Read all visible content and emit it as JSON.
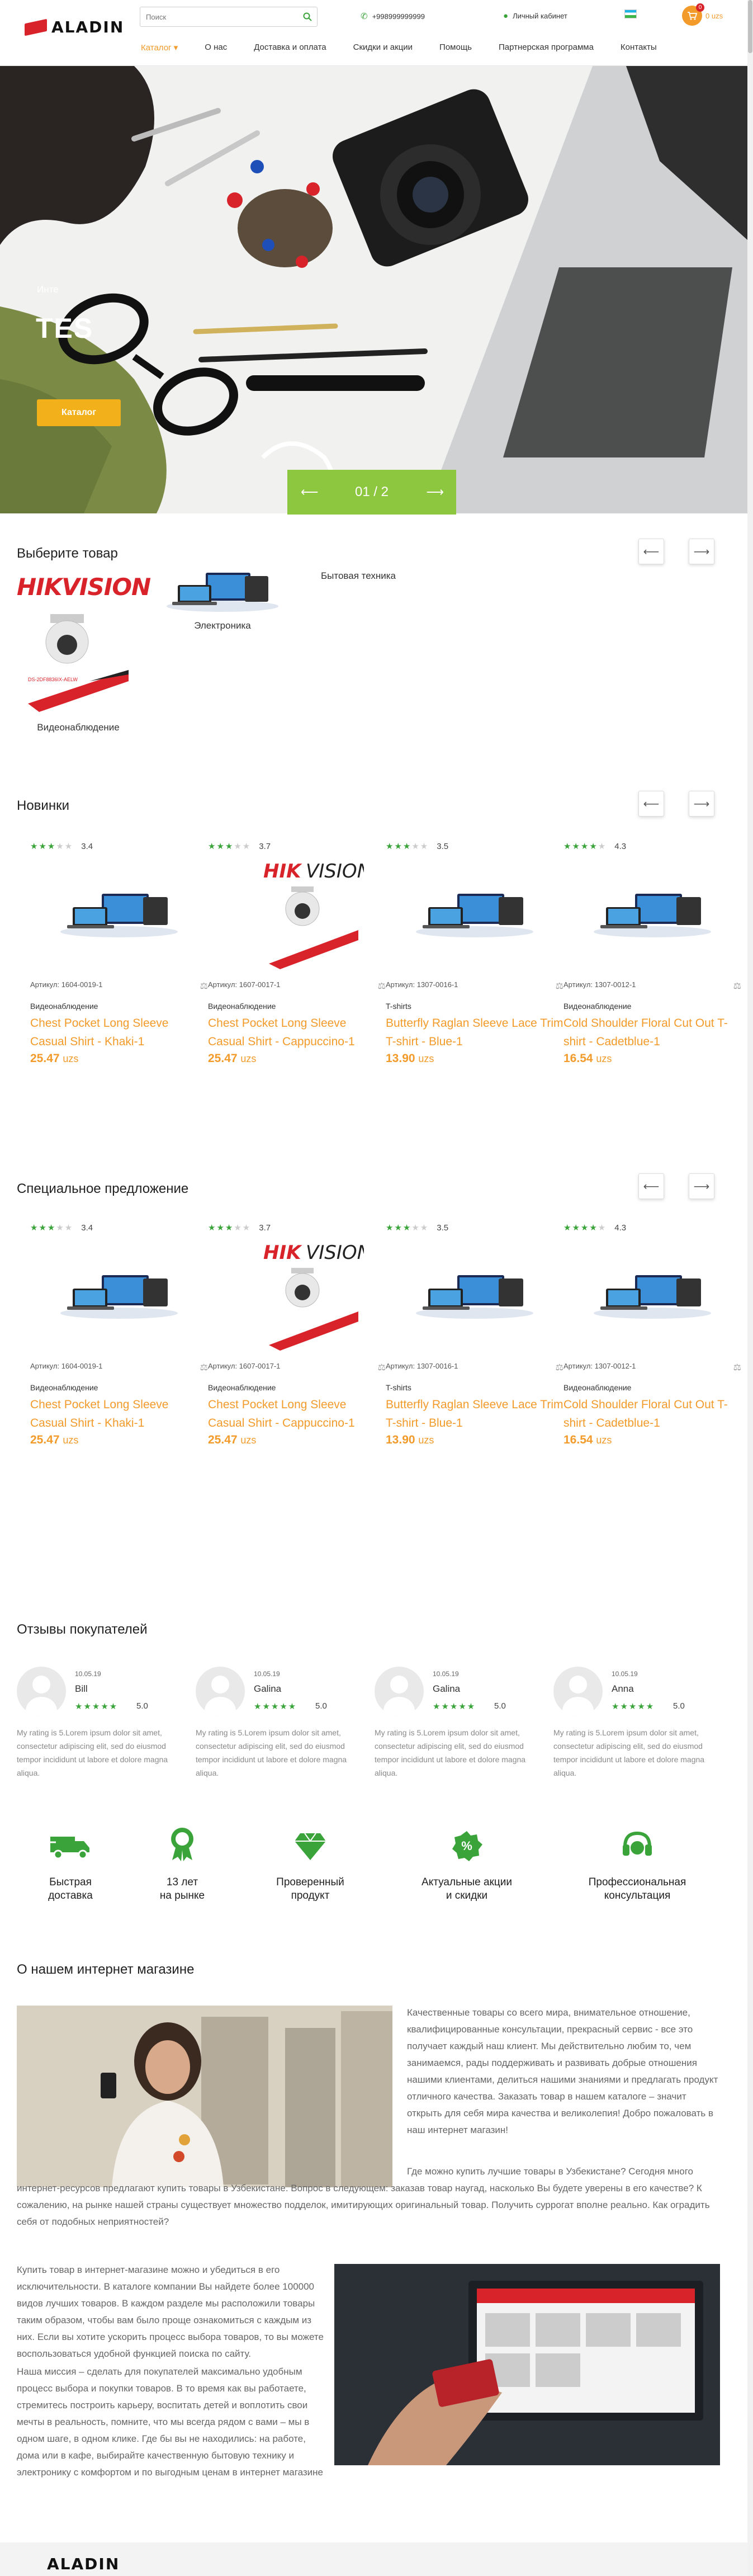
{
  "header": {
    "logo": "ALADIN",
    "search_placeholder": "Поиск",
    "phone": "+998999999999",
    "cabinet": "Личный кабинет",
    "cart_count": "0",
    "cart_sum": "0 uzs",
    "menu": [
      "Каталог",
      "О нас",
      "Доставка и оплата",
      "Скидки и акции",
      "Помощь",
      "Партнерская программа",
      "Контакты"
    ]
  },
  "hero": {
    "subtitle": "Инте",
    "title": "TES",
    "button": "Каталог",
    "counter": "01 / 2",
    "prev": "⟵",
    "next": "⟶"
  },
  "categories_section": {
    "title": "Выберите товар",
    "items": [
      "Электроника",
      "Бытовая техника",
      "Видеонаблюдение"
    ],
    "brand": "HIKVISION"
  },
  "new_section": {
    "title": "Новинки"
  },
  "special_section": {
    "title": "Специальное предложение"
  },
  "products": [
    {
      "rating": "3.4",
      "stars": 3,
      "sku": "Артикул: 1604-0019-1",
      "category": "Видеонаблюдение",
      "name": "Chest Pocket Long Sleeve Casual Shirt - Khaki-1",
      "price": "25.47",
      "currency": "uzs",
      "image": "electronics"
    },
    {
      "rating": "3.7",
      "stars": 3,
      "sku": "Артикул: 1607-0017-1",
      "category": "Видеонаблюдение",
      "name": "Chest Pocket Long Sleeve Casual Shirt - Cappuccino-1",
      "price": "25.47",
      "currency": "uzs",
      "image": "hikvision"
    },
    {
      "rating": "3.5",
      "stars": 3,
      "sku": "Артикул: 1307-0016-1",
      "category": "T-shirts",
      "name": "Butterfly Raglan Sleeve Lace Trim T-shirt - Blue-1",
      "price": "13.90",
      "currency": "uzs",
      "image": "electronics"
    },
    {
      "rating": "4.3",
      "stars": 4,
      "sku": "Артикул: 1307-0012-1",
      "category": "Видеонаблюдение",
      "name": "Cold Shoulder Floral Cut Out T-shirt - Cadetblue-1",
      "price": "16.54",
      "currency": "uzs",
      "image": "electronics"
    }
  ],
  "reviews_section": {
    "title": "Отзывы покупателей",
    "items": [
      {
        "date": "10.05.19",
        "name": "Bill",
        "score": "5.0",
        "text": "My rating is 5.Lorem ipsum dolor sit amet, consectetur adipiscing elit, sed do eiusmod tempor incididunt ut labore et dolore magna aliqua."
      },
      {
        "date": "10.05.19",
        "name": "Galina",
        "score": "5.0",
        "text": "My rating is 5.Lorem ipsum dolor sit amet, consectetur adipiscing elit, sed do eiusmod tempor incididunt ut labore et dolore magna aliqua."
      },
      {
        "date": "10.05.19",
        "name": "Galina",
        "score": "5.0",
        "text": "My rating is 5.Lorem ipsum dolor sit amet, consectetur adipiscing elit, sed do eiusmod tempor incididunt ut labore et dolore magna aliqua."
      },
      {
        "date": "10.05.19",
        "name": "Anna",
        "score": "5.0",
        "text": "My rating is 5.Lorem ipsum dolor sit amet, consectetur adipiscing elit, sed do eiusmod tempor incididunt ut labore et dolore magna aliqua."
      }
    ]
  },
  "advantages": [
    {
      "line1": "Быстрая",
      "line2": "доставка",
      "icon": "truck-icon"
    },
    {
      "line1": "13 лет",
      "line2": "на рынке",
      "icon": "award-icon"
    },
    {
      "line1": "Проверенный",
      "line2": "продукт",
      "icon": "diamond-icon"
    },
    {
      "line1": "Актуальные акции",
      "line2": "и скидки",
      "icon": "percent-icon"
    },
    {
      "line1": "Профессиональная",
      "line2": "консультация",
      "icon": "headset-icon"
    }
  ],
  "about": {
    "title": "О нашем интернет магазине",
    "p1": "Качественные товары со всего мира, внимательное отношение, квалифицированные консультации, прекрасный сервис - все это получает каждый наш клиент. Мы действительно любим то, чем занимаемся, рады поддерживать и развивать добрые отношения нашими клиентами, делиться нашими знаниями и предлагать продукт отличного качества. Заказать товар в нашем каталоге – значит открыть для себя мира качества и великолепия! Добро пожаловать в наш интернет магазин!",
    "p2": "Где можно купить лучшие товары в Узбекистане? Сегодня много интернет-ресурсов предлагают купить товары в Узбекистане. Вопрос в следующем: заказав товар наугад, насколько Вы будете уверены в его качестве? К сожалению, на рынке нашей страны существует множество подделок, имитирующих оригинальный товар. Получить суррогат вполне реально. Как оградить себя от подобных неприятностей?",
    "p3": "Купить товар в интернет-магазине можно и убедиться в его исключительности. В каталоге компании Вы найдете более 100000 видов лучших товаров. В каждом разделе мы расположили товары таким образом, чтобы вам было проще ознакомиться с каждым из них. Если вы хотите ускорить процесс выбора товаров, то вы можете воспользоваться удобной функцией поиска по сайту.",
    "p4": "Наша миссия – сделать для покупателей максимально удобным процесс выбора и покупки товаров. В то время как вы работаете, стремитесь построить карьеру, воспитать детей и воплотить свои мечты в реальность, помните, что мы всегда рядом с вами – мы в одном шаге, в одном клике. Где бы вы не находились: на работе, дома или в кафе, выбирайте качественную бытовую технику и электронику с комфортом и по выгодным ценам в интернет магазине"
  },
  "footer": {
    "logo": "ALADIN"
  },
  "colors": {
    "accent": "#f29b2b",
    "green": "#3aa43a",
    "red": "#d8232a",
    "slider": "#8dc63f"
  }
}
